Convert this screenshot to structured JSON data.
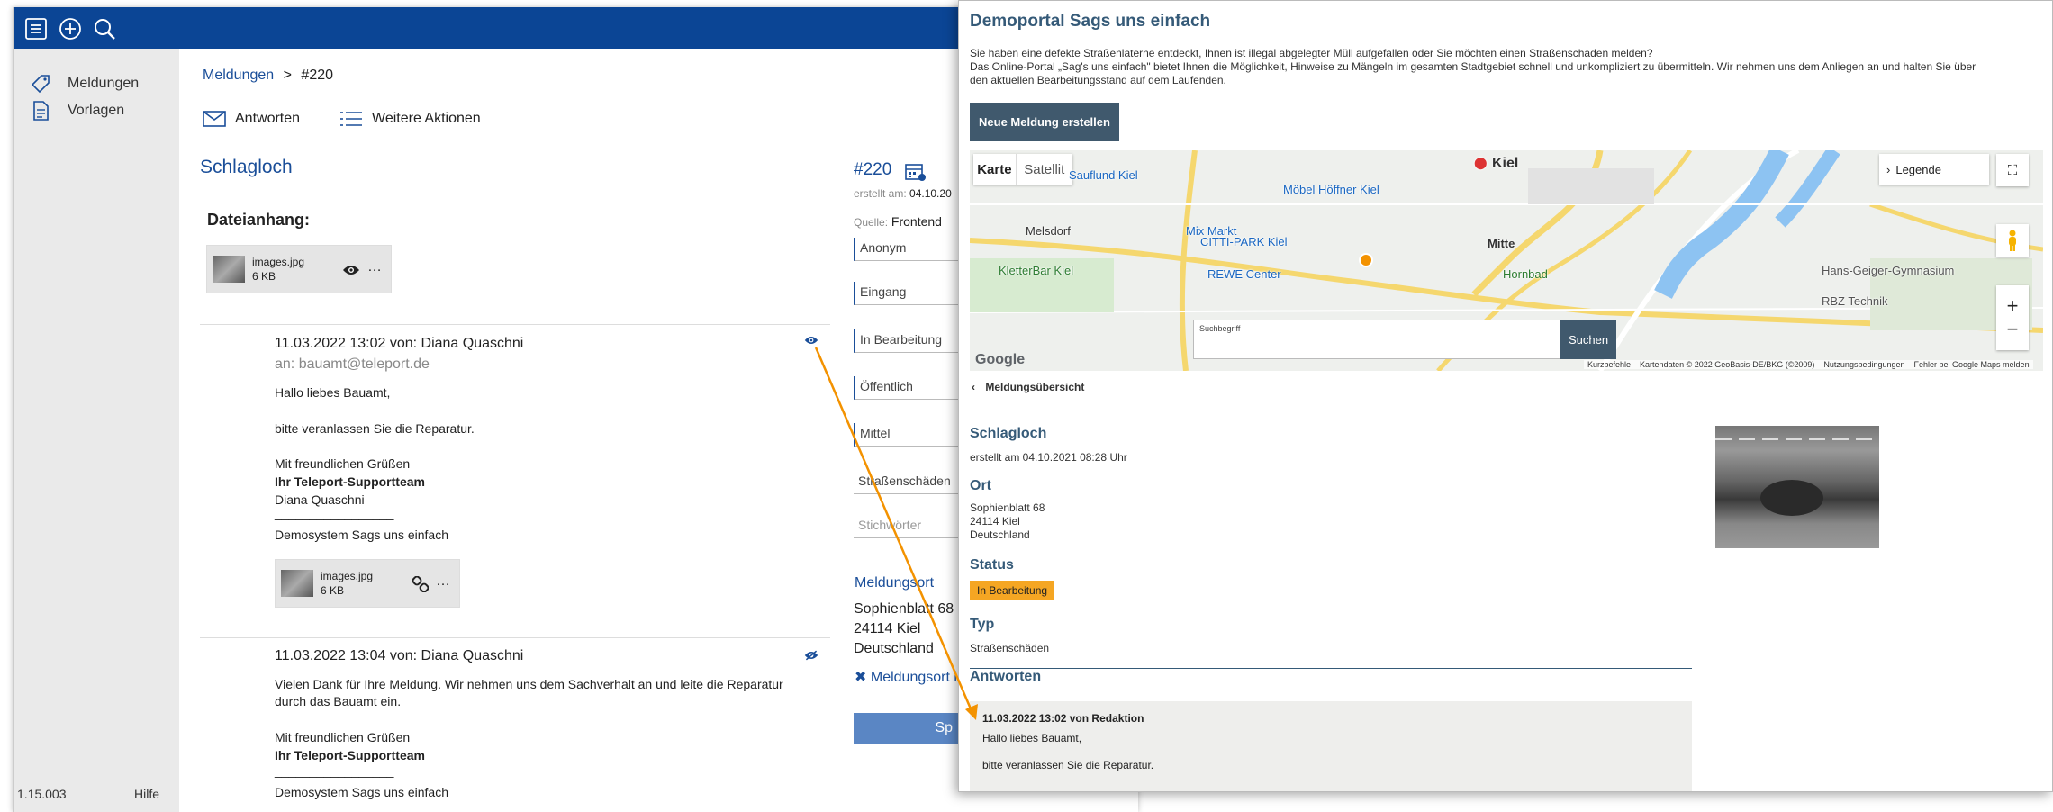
{
  "back_app": {
    "sidebar": {
      "items": [
        {
          "label": "Meldungen",
          "icon": "tag-icon"
        },
        {
          "label": "Vorlagen",
          "icon": "document-icon"
        }
      ],
      "version": "1.15.003",
      "help": "Hilfe"
    },
    "breadcrumb": {
      "root": "Meldungen",
      "sep": ">",
      "current": "#220"
    },
    "toolbar": {
      "reply": "Antworten",
      "more": "Weitere Aktionen"
    },
    "title": "Schlagloch",
    "attachments_label": "Dateianhang:",
    "attachment": {
      "name": "images.jpg",
      "size": "6 KB"
    },
    "messages": [
      {
        "header": "11.03.2022 13:02 von: Diana Quaschni",
        "to": "an: bauamt@teleport.de",
        "lines": [
          "Hallo liebes Bauamt,",
          "bitte veranlassen Sie die Reparatur.",
          "Mit freundlichen Grüßen",
          "Ihr Teleport-Supportteam",
          "Diana Quaschni",
          "_________________",
          "Demosystem Sags uns einfach"
        ],
        "attachment": {
          "name": "images.jpg",
          "size": "6 KB"
        }
      },
      {
        "header": "11.03.2022 13:04 von: Diana Quaschni",
        "lines": [
          "Vielen Dank für Ihre Meldung. Wir nehmen uns dem Sachverhalt an und leite die Reparatur",
          "durch das Bauamt ein.",
          "Mit freundlichen Grüßen",
          "Ihr Teleport-Supportteam",
          "_________________",
          "Demosystem Sags uns einfach"
        ]
      }
    ],
    "detail": {
      "id": "#220",
      "created_label": "erstellt am:",
      "created_value": "04.10.20",
      "source_label": "Quelle:",
      "source_value": "Frontend",
      "fields": [
        "Anonym",
        "Eingang",
        "In Bearbeitung",
        "Öffentlich",
        "Mittel",
        "Straßenschäden",
        "Stichwörter"
      ],
      "location_label": "Meldungsort",
      "location_lines": [
        "Sophienblatt 68",
        "24114 Kiel",
        "Deutschland"
      ],
      "location_remove": "Meldungsort l",
      "save_label": "Sp"
    }
  },
  "front_app": {
    "title": "Demoportal Sags uns einfach",
    "intro": [
      "Sie haben eine defekte Straßenlaterne entdeckt, Ihnen ist illegal abgelegter Müll aufgefallen oder Sie möchten einen Straßenschaden melden?",
      "Das Online-Portal „Sag's uns einfach\" bietet Ihnen die Möglichkeit, Hinweise zu Mängeln im gesamten Stadtgebiet schnell und unkompliziert zu übermitteln. Wir nehmen uns dem Anliegen an und halten Sie über",
      "den aktuellen Bearbeitungsstand auf dem Laufenden."
    ],
    "new_report_button": "Neue Meldung erstellen",
    "map": {
      "tab_map": "Karte",
      "tab_satellite": "Satellit",
      "legend": "Legende",
      "search_label": "Suchbegriff",
      "search_button": "Suchen",
      "places": [
        "Kiel",
        "Mitte",
        "Melsdorf",
        "Hornbad",
        "Möbel Höffner Kiel",
        "Mix Markt",
        "CITTI-PARK Kiel",
        "KletterBar Kiel",
        "REWE Center",
        "Hans-Geiger-Gymnasium",
        "RBZ Technik",
        "Sauflund Kiel"
      ],
      "footer": [
        "Kurzbefehle",
        "Kartendaten © 2022 GeoBasis-DE/BKG (©2009)",
        "Nutzungsbedingungen",
        "Fehler bei Google Maps melden"
      ],
      "logo": "Google"
    },
    "back_link": "Meldungsübersicht",
    "report": {
      "title": "Schlagloch",
      "created": "erstellt am 04.10.2021 08:28 Uhr",
      "location_heading": "Ort",
      "location_lines": [
        "Sophienblatt 68",
        "24114 Kiel",
        "Deutschland"
      ],
      "status_heading": "Status",
      "status_value": "In Bearbeitung",
      "type_heading": "Typ",
      "type_value": "Straßenschäden",
      "answers_heading": "Antworten",
      "answer_header": "11.03.2022 13:02 von Redaktion",
      "answer_lines": [
        "Hallo liebes Bauamt,",
        "bitte veranlassen Sie die Reparatur."
      ]
    }
  },
  "colors": {
    "header_blue": "#0b4595",
    "link_blue": "#1a4e99",
    "status_orange": "#f5a623",
    "arrow_orange": "#f39200",
    "portal_title": "#355a78"
  }
}
